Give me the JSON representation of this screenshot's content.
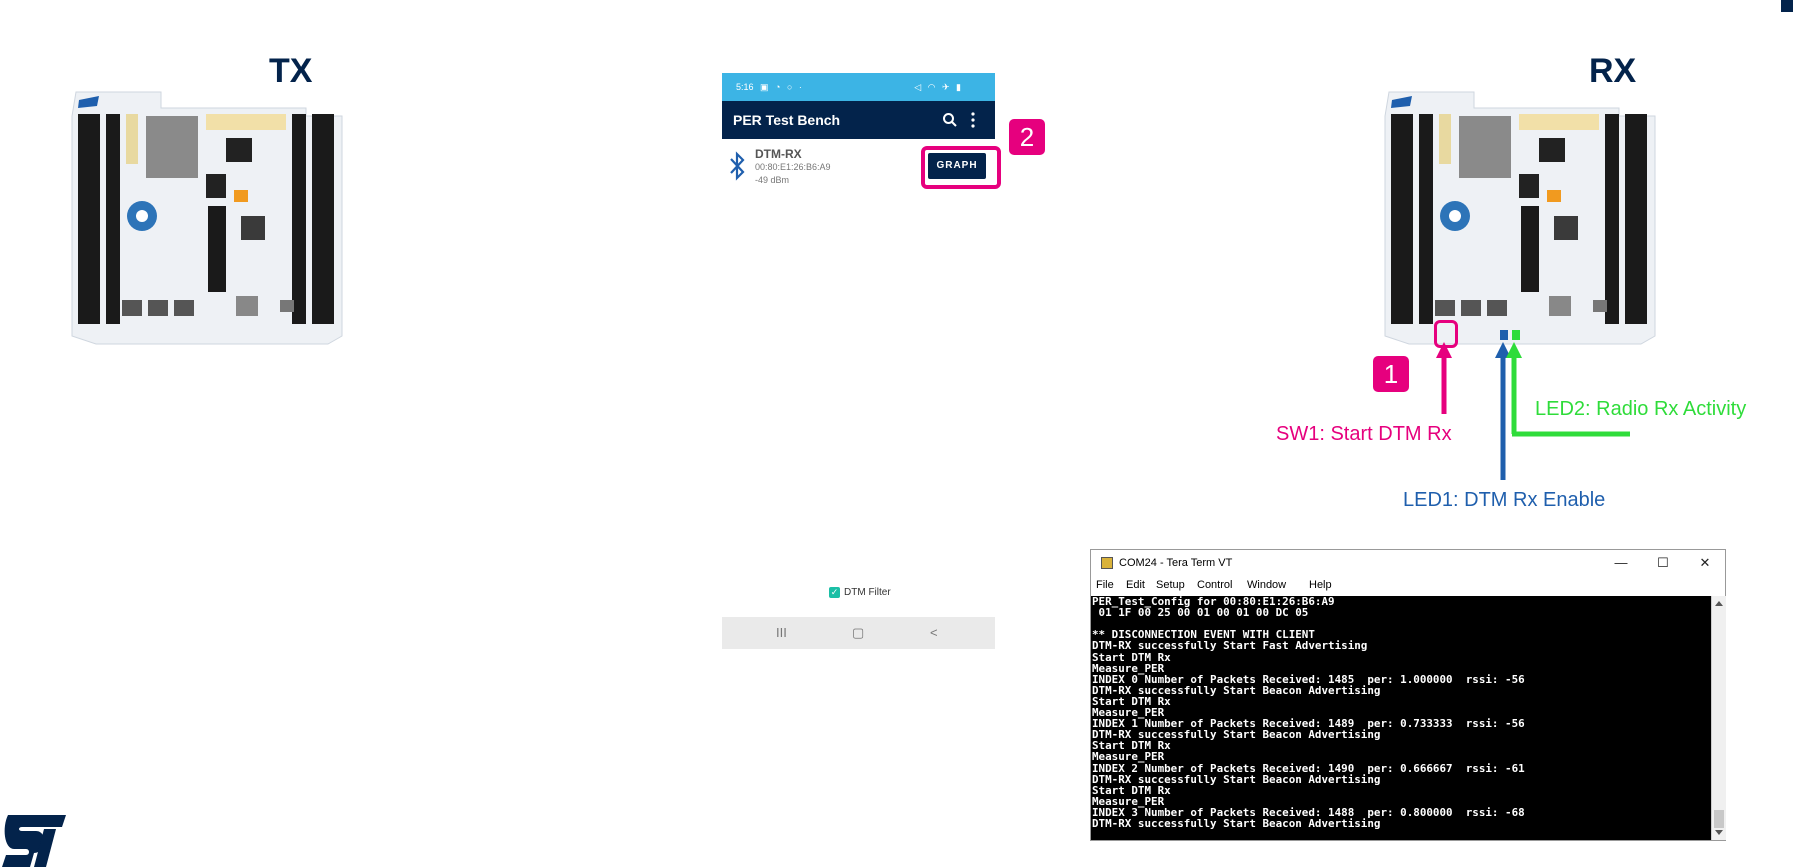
{
  "labels": {
    "tx_title": "TX",
    "rx_title": "RX",
    "sw1": "SW1: Start DTM Rx",
    "led1": "LED1: DTM Rx Enable",
    "led2": "LED2: Radio Rx Activity",
    "badge1": "1",
    "badge2": "2"
  },
  "phone": {
    "status_time": "5:16",
    "app_title": "PER Test Bench",
    "device_name": "DTM-RX",
    "device_mac": "00:80:E1:26:B6:A9",
    "device_rssi": "-49 dBm",
    "graph_button": "GRAPH",
    "filter_label": "DTM Filter",
    "filter_checked": true,
    "nav_recent": "III",
    "nav_home": "▢",
    "nav_back": "<"
  },
  "terminal": {
    "title": "COM24 - Tera Term VT",
    "menu": [
      "File",
      "Edit",
      "Setup",
      "Control",
      "Window",
      "Help"
    ],
    "lines": [
      "PER_Test_Config for 00:80:E1:26:B6:A9",
      " 01 1F 00 25 00 01 00 01 00 DC 05",
      "",
      "** DISCONNECTION EVENT WITH CLIENT",
      "DTM-RX successfully Start Fast Advertising",
      "Start DTM Rx",
      "Measure_PER",
      "INDEX 0 Number of Packets Received: 1485  per: 1.000000  rssi: -56",
      "DTM-RX successfully Start Beacon Advertising",
      "Start DTM Rx",
      "Measure_PER",
      "INDEX 1 Number of Packets Received: 1489  per: 0.733333  rssi: -56",
      "DTM-RX successfully Start Beacon Advertising",
      "Start DTM Rx",
      "Measure_PER",
      "INDEX 2 Number of Packets Received: 1490  per: 0.666667  rssi: -61",
      "DTM-RX successfully Start Beacon Advertising",
      "Start DTM Rx",
      "Measure_PER",
      "INDEX 3 Number of Packets Received: 1488  per: 0.800000  rssi: -68",
      "DTM-RX successfully Start Beacon Advertising"
    ]
  },
  "colors": {
    "magenta": "#e6007e",
    "blue": "#1f5fad",
    "green": "#2fdc3a",
    "st_navy": "#03234b",
    "phone_status": "#3cb4e5"
  },
  "icons": {
    "search": "search-icon",
    "more": "more-vertical-icon",
    "bluetooth": "bluetooth-icon",
    "checkbox": "checkbox-checked-icon"
  }
}
